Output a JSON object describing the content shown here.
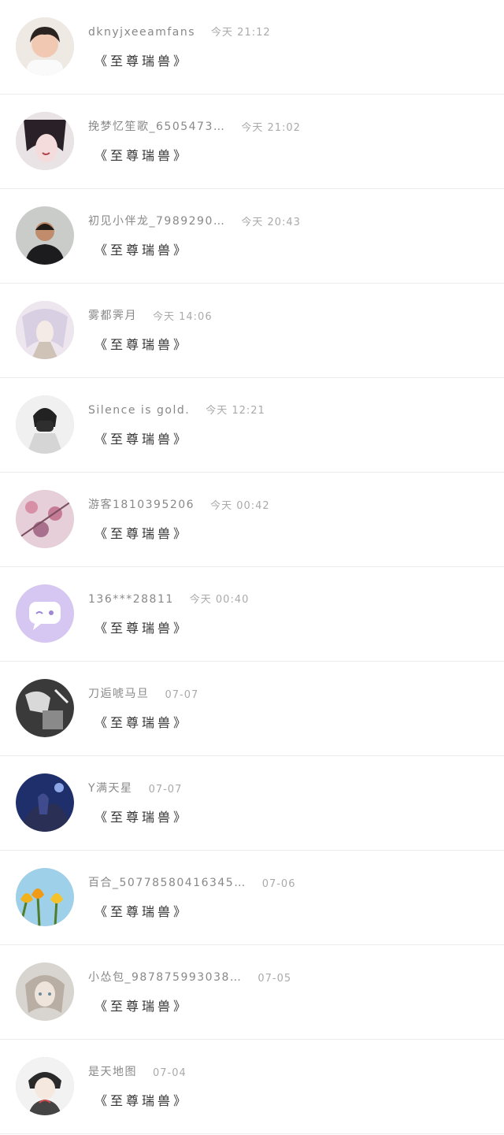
{
  "messages": [
    {
      "name": "dknyjxeeamfans",
      "time": "今天 21:12",
      "title": "《至尊瑞兽》",
      "avatar_icon": "girl-photo-avatar"
    },
    {
      "name": "挽梦忆笙歌_6505473…",
      "time": "今天 21:02",
      "title": "《至尊瑞兽》",
      "avatar_icon": "anime-girl-avatar"
    },
    {
      "name": "初见小伴龙_7989290…",
      "time": "今天 20:43",
      "title": "《至尊瑞兽》",
      "avatar_icon": "man-photo-avatar"
    },
    {
      "name": "雾都霁月",
      "time": "今天 14:06",
      "title": "《至尊瑞兽》",
      "avatar_icon": "anime-character-avatar"
    },
    {
      "name": "Silence is gold.",
      "time": "今天 12:21",
      "title": "《至尊瑞兽》",
      "avatar_icon": "masked-man-avatar"
    },
    {
      "name": "游客1810395206",
      "time": "今天 00:42",
      "title": "《至尊瑞兽》",
      "avatar_icon": "pink-flowers-avatar"
    },
    {
      "name": "136***28811",
      "time": "今天 00:40",
      "title": "《至尊瑞兽》",
      "avatar_icon": "default-chat-avatar"
    },
    {
      "name": "刀逅唬马旦",
      "time": "07-07",
      "title": "《至尊瑞兽》",
      "avatar_icon": "bw-photo-avatar"
    },
    {
      "name": "Y满天星",
      "time": "07-07",
      "title": "《至尊瑞兽》",
      "avatar_icon": "blue-night-avatar"
    },
    {
      "name": "百合_50778580416345…",
      "time": "07-06",
      "title": "《至尊瑞兽》",
      "avatar_icon": "tulips-avatar"
    },
    {
      "name": "小怂包_987875993038…",
      "time": "07-05",
      "title": "《至尊瑞兽》",
      "avatar_icon": "anime-girl-soft-avatar"
    },
    {
      "name": "是天地图",
      "time": "07-04",
      "title": "《至尊瑞兽》",
      "avatar_icon": "anime-boy-avatar"
    }
  ]
}
